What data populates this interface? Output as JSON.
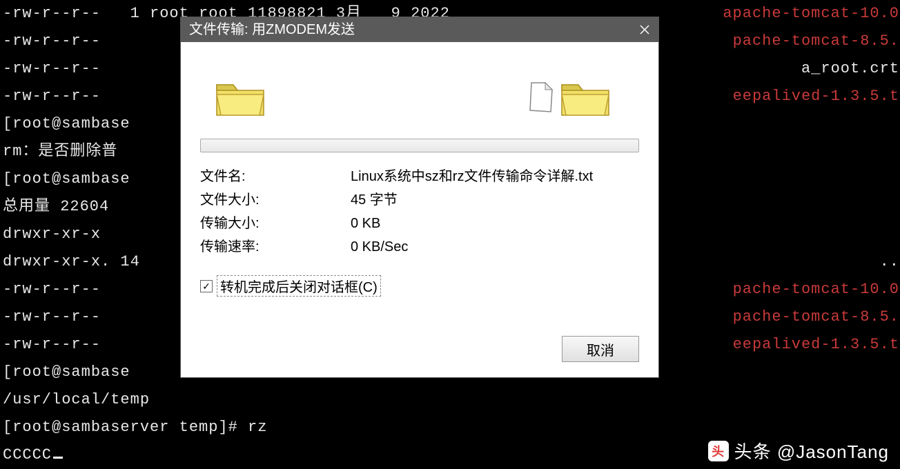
{
  "terminal": {
    "lines": [
      {
        "left": "-rw-r--r--   1 root root 11898821 3月   9 2022 ",
        "right": "apache-tomcat-10.0"
      },
      {
        "left": "-rw-r--r--",
        "right": "pache-tomcat-8.5."
      },
      {
        "left": "-rw-r--r--",
        "right": "a_root.crt",
        "rightColor": "white"
      },
      {
        "left": "-rw-r--r--",
        "right": "eepalived-1.3.5.t"
      },
      {
        "left": "[root@sambase",
        "right": ""
      },
      {
        "left": "rm：是否删除普",
        "right": ""
      },
      {
        "left": "[root@sambase",
        "right": ""
      },
      {
        "left": "总用量 22604",
        "right": ""
      },
      {
        "left": "drwxr-xr-x",
        "right": ""
      },
      {
        "left": "drwxr-xr-x. 14",
        "right": ".."
      },
      {
        "left": "-rw-r--r--",
        "right": "pache-tomcat-10.0"
      },
      {
        "left": "-rw-r--r--",
        "right": "pache-tomcat-8.5."
      },
      {
        "left": "-rw-r--r--",
        "right": "eepalived-1.3.5.t"
      },
      {
        "left": "[root@sambase",
        "right": ""
      },
      {
        "left": "/usr/local/temp",
        "right": ""
      },
      {
        "left": "[root@sambaserver temp]# rz",
        "right": ""
      },
      {
        "left": "CCCCC",
        "right": "",
        "hasCursor": true
      }
    ]
  },
  "dialog": {
    "title": "文件传输: 用ZMODEM发送",
    "filename_label": "文件名:",
    "filename_value": "Linux系统中sz和rz文件传输命令详解.txt",
    "filesize_label": "文件大小:",
    "filesize_value": "45 字节",
    "transfer_label": "传输大小:",
    "transfer_value": "0 KB",
    "speed_label": "传输速率:",
    "speed_value": "0 KB/Sec",
    "checkbox_label": "转机完成后关闭对话框(C)",
    "checkbox_checked": "✓",
    "cancel_label": "取消"
  },
  "watermark": "头条 @JasonTang"
}
